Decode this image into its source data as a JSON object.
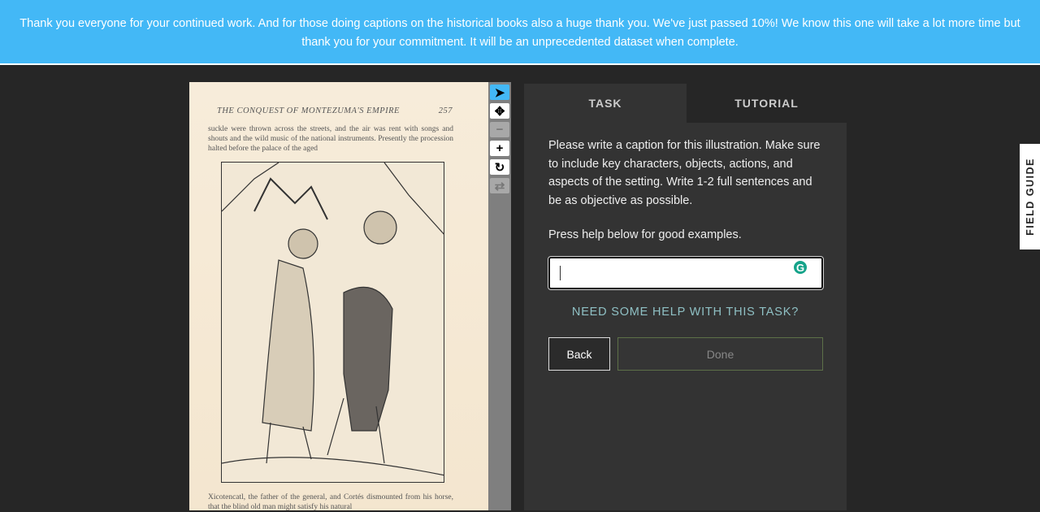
{
  "banner": {
    "text": "Thank you everyone for your continued work. And for those doing captions on the historical books also a huge thank you. We've just passed 10%! We know this one will take a lot more time but thank you for your commitment. It will be an unprecedented dataset when complete."
  },
  "page": {
    "running_header": "THE CONQUEST OF MONTEZUMA'S EMPIRE",
    "page_number": "257",
    "top_text": "suckle were thrown across the streets, and the air was rent with songs and shouts and the wild music of the national instruments. Presently the procession halted before the palace of the aged",
    "bottom_text": "Xicotencatl, the father of the general, and Cortés dismounted from his horse, that the blind old man might satisfy his natural"
  },
  "toolbar": {
    "tools": [
      "pointer-icon",
      "move-icon",
      "zoom-out-icon",
      "zoom-in-icon",
      "rotate-icon",
      "reset-icon"
    ],
    "active": "pointer-icon",
    "accent": "#43b8f6"
  },
  "tabs": [
    {
      "label": "TASK",
      "active": true
    },
    {
      "label": "TUTORIAL",
      "active": false
    }
  ],
  "task": {
    "instruction": "Please write a caption for this illustration. Make sure to include key characters, objects, actions, and aspects of the setting. Write 1-2 full sentences and be as objective as possible.",
    "help_hint": "Press help below for good examples.",
    "caption_value": "",
    "help_link": "NEED SOME HELP WITH THIS TASK?",
    "back_label": "Back",
    "done_label": "Done"
  },
  "field_guide": {
    "label": "FIELD GUIDE"
  }
}
